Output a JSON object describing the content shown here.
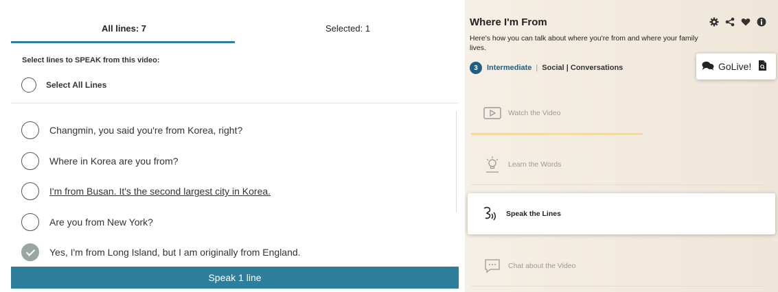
{
  "tabs": {
    "all_lines": "All lines: 7",
    "selected": "Selected: 1"
  },
  "instruction": "Select lines to SPEAK from this video:",
  "select_all_label": "Select All Lines",
  "lines": [
    {
      "text": "Changmin, you said you're from Korea, right?",
      "checked": false
    },
    {
      "text": "Where in Korea are you from?",
      "checked": false
    },
    {
      "text": "I'm from Busan. It's the second largest city in Korea.",
      "checked": false
    },
    {
      "text": "Are you from New York?",
      "checked": false
    },
    {
      "text": "Yes, I'm from Long Island, but I am originally from England.",
      "checked": true
    }
  ],
  "speak_button": "Speak 1 line",
  "lesson": {
    "title": "Where I'm From",
    "description": "Here's how you can talk about where you're from and where your family lives.",
    "level_number": "3",
    "level": "Intermediate",
    "category_sep": "|",
    "categories": "Social | Conversations",
    "golive": "GoLive!"
  },
  "steps": {
    "watch": "Watch the Video",
    "learn": "Learn the Words",
    "speak": "Speak the Lines",
    "chat": "Chat about the Video"
  },
  "icons": {
    "settings": "gear-icon",
    "share": "share-icon",
    "favorite": "heart-icon",
    "info": "info-icon"
  },
  "colors": {
    "accent": "#2d7e9b",
    "level_badge": "#1f5f86",
    "progress_bar": "#f3d9a4",
    "checked_radio": "#9aa5a4"
  }
}
